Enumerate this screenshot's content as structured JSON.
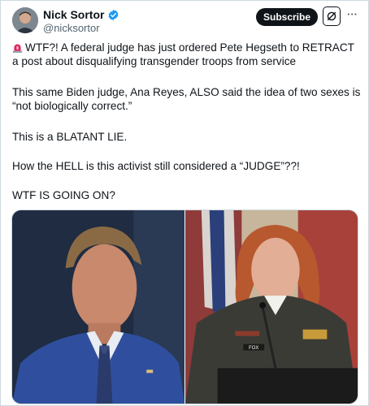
{
  "author": {
    "display_name": "Nick Sortor",
    "handle": "@nicksortor"
  },
  "header": {
    "subscribe_label": "Subscribe",
    "more_icon": "···"
  },
  "tweet": {
    "line1": "WTF?! A federal judge has just ordered Pete Hegseth to RETRACT a post about disqualifying transgender troops from service",
    "line2": "This same Biden judge, Ana Reyes, ALSO said the idea of two sexes is “not biologically correct.”",
    "line3": "This is a BLATANT LIE.",
    "line4": "How the HELL is this activist still considered a “JUDGE”??!",
    "line5": "WTF IS GOING ON?"
  },
  "media": {
    "right_nametag": "FOX"
  },
  "colors": {
    "verified": "#1d9bf0",
    "text": "#0f1419",
    "secondary": "#536471",
    "siren": "#e0245e"
  },
  "icons": [
    "siren-icon",
    "verified-badge-icon",
    "grok-icon",
    "more-icon"
  ]
}
